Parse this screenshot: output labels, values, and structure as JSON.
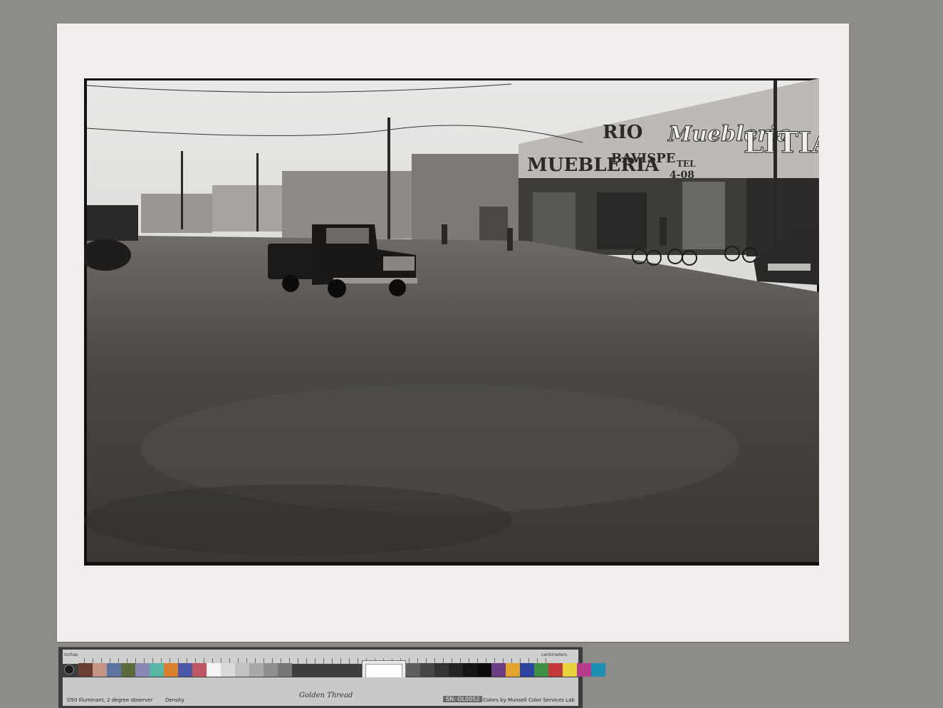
{
  "photo": {
    "signs": {
      "muebleria_left": "MUEBLERIA",
      "rio": "RIO",
      "bavispe": "BAVISPE",
      "muebleria_script": "Muebleria",
      "litian": "LITIAN",
      "tel": "TEL",
      "tel_number": "4-08"
    }
  },
  "target": {
    "inches_label": "inches",
    "centimeters_label": "centimeters",
    "golden_thread": "Golden Thread",
    "serial": "SN: OL0052",
    "illuminant": "D50 Illuminant, 2 degree observer",
    "density": "Density",
    "munsell": "Colors by Munsell Color Services Lab",
    "swatch_colors_left": [
      "#6a3f33",
      "#c69485",
      "#5d75a0",
      "#5b6b3a",
      "#8a86b6",
      "#58b7a6",
      "#d77f2d",
      "#4b58a6",
      "#c05563",
      "#f4f4f2",
      "#dadad8",
      "#c2c2c0",
      "#a9a9a7",
      "#8f8f8d",
      "#767674"
    ],
    "swatch_colors_right": [
      "#5e5e5c",
      "#464644",
      "#333331",
      "#242422",
      "#151513",
      "#0c0c0b",
      "#6a3f86",
      "#e3a530",
      "#2c43a0",
      "#3f8f45",
      "#c23a3a",
      "#e8d43c",
      "#b43a8b",
      "#1d8fb5"
    ]
  }
}
